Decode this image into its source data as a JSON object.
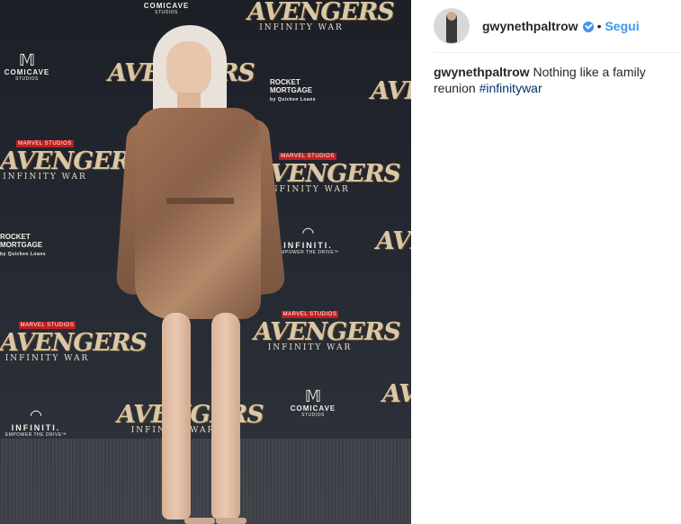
{
  "post": {
    "username": "gwynethpaltrow",
    "follow_label": "Segui",
    "separator": "•",
    "verified_icon": "verified-badge-icon",
    "caption_username": "gwynethpaltrow",
    "caption_text": "Nothing like a family reunion",
    "hashtag": "#infinitywar"
  },
  "backdrop": {
    "avengers": "AVENGERS",
    "infinity_war": "INFINITY WAR",
    "marvel_studios": "MARVEL STUDIOS",
    "comicave": "COMICAVE",
    "studios": "STUDIOS",
    "rocket_mortgage_1": "ROCKET",
    "rocket_mortgage_2": "MORTGAGE",
    "quicken": "by Quicken Loans",
    "infiniti": "INFINITI.",
    "drive": "EMPOWER THE DRIVE™"
  },
  "colors": {
    "accent_blue": "#3897f0",
    "hashtag": "#003569",
    "text": "#262626"
  }
}
